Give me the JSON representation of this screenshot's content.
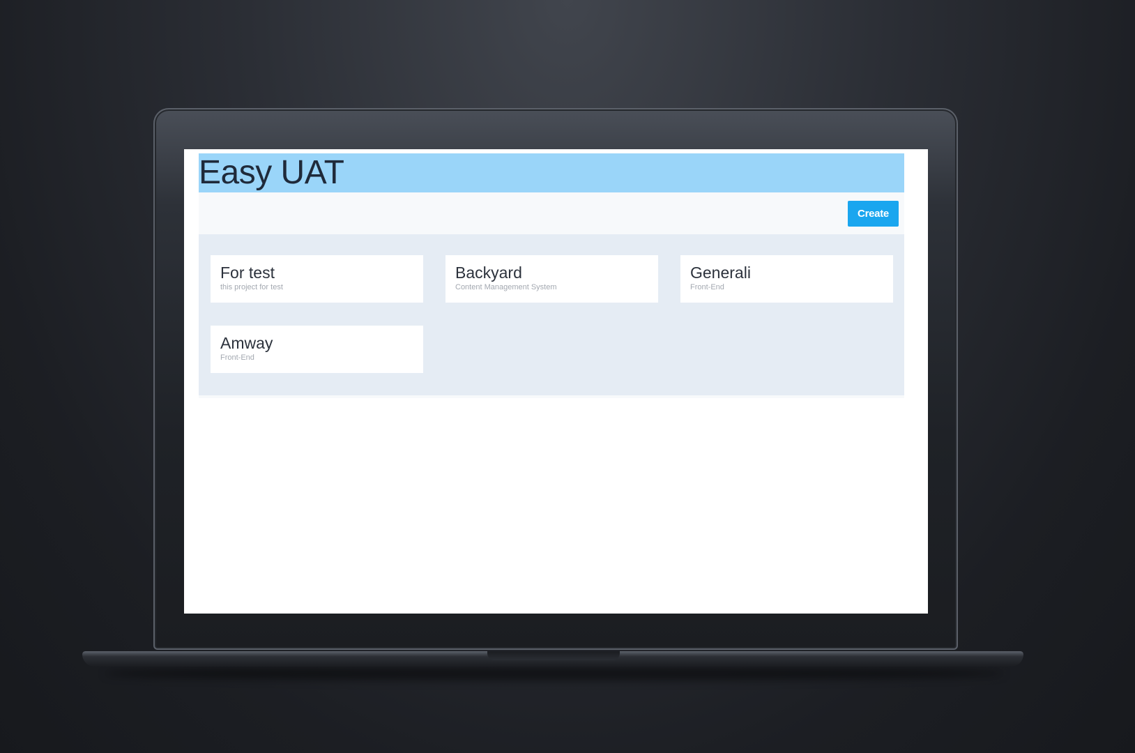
{
  "app": {
    "title": "Easy UAT",
    "create_label": "Create"
  },
  "projects": [
    {
      "name": "For test",
      "description": "this project for test"
    },
    {
      "name": "Backyard",
      "description": "Content Management System"
    },
    {
      "name": "Generali",
      "description": "Front-End"
    },
    {
      "name": "Amway",
      "description": "Front-End"
    }
  ],
  "colors": {
    "header_bg": "#9ad5f9",
    "create_button": "#1aa6ef",
    "project_area_bg": "#e5ecf4"
  }
}
